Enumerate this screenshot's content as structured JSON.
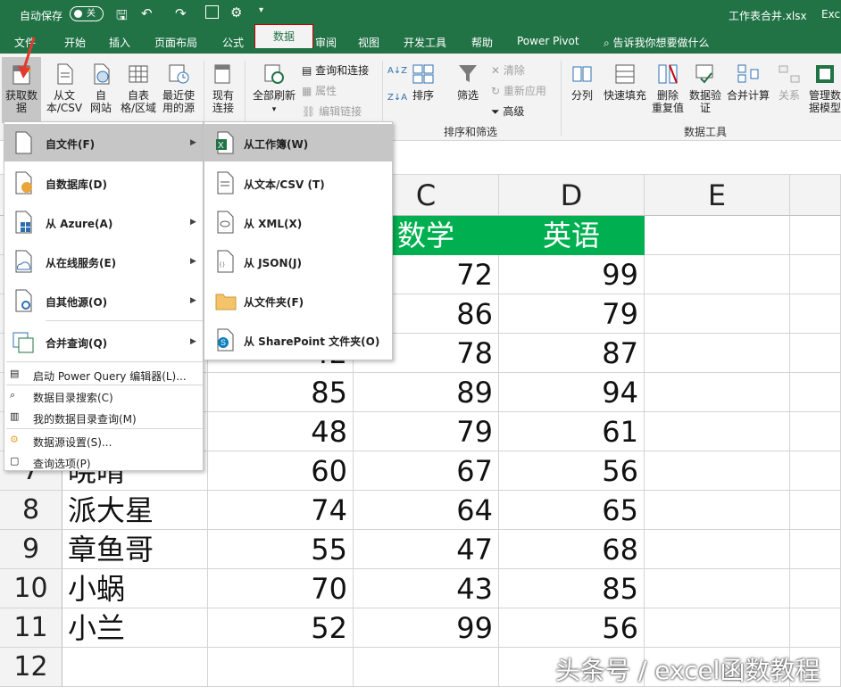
{
  "titlebar": {
    "autosave_label": "自动保存",
    "autosave_state": "关",
    "filename": "工作表合并.xlsx",
    "app": "Exc"
  },
  "menu_tabs": [
    "文件",
    "开始",
    "插入",
    "页面布局",
    "公式",
    "数据",
    "审阅",
    "视图",
    "开发工具",
    "帮助",
    "Power Pivot"
  ],
  "active_tab": "数据",
  "tell_me": "告诉我你想要做什么",
  "ribbon": {
    "get_data": "获取数\n据",
    "from_text_csv": "从文\n本/CSV",
    "from_web": "自\n网站",
    "from_table": "自表\n格/区域",
    "recent_sources": "最近使\n用的源",
    "existing_conn": "现有\n连接",
    "refresh_all": "全部刷新",
    "queries_conn": "查询和连接",
    "properties": "属性",
    "edit_links": "编辑链接",
    "sort_az": "A↓Z",
    "sort_za": "Z↓A",
    "sort": "排序",
    "filter": "筛选",
    "clear": "清除",
    "reapply": "重新应用",
    "advanced": "高级",
    "sort_filter_group": "排序和筛选",
    "split": "分列",
    "flash_fill": "快速填充",
    "remove_dup": "删除\n重复值",
    "validation": "数据验\n证",
    "consolidate": "合并计算",
    "relations": "关系",
    "manage_model": "管理数\n据模型",
    "data_tools_group": "数据工具"
  },
  "columns": [
    "C",
    "D",
    "E"
  ],
  "rows": [
    {
      "n": "",
      "name": "",
      "b": "",
      "c": "数学",
      "d": "英语"
    },
    {
      "n": "",
      "name": "",
      "b": "",
      "c": "72",
      "d": "99"
    },
    {
      "n": "",
      "name": "",
      "b": "",
      "c": "86",
      "d": "79"
    },
    {
      "n": "",
      "name": "",
      "b": "42",
      "c": "78",
      "d": "87"
    },
    {
      "n": "",
      "name": "",
      "b": "85",
      "c": "89",
      "d": "94"
    },
    {
      "n": "",
      "name": "",
      "b": "48",
      "c": "79",
      "d": "61"
    },
    {
      "n": "7",
      "name": "晓晴",
      "b": "60",
      "c": "67",
      "d": "56"
    },
    {
      "n": "8",
      "name": "派大星",
      "b": "74",
      "c": "64",
      "d": "65"
    },
    {
      "n": "9",
      "name": "章鱼哥",
      "b": "55",
      "c": "47",
      "d": "68"
    },
    {
      "n": "10",
      "name": "小蜗",
      "b": "70",
      "c": "43",
      "d": "85"
    },
    {
      "n": "11",
      "name": "小兰",
      "b": "52",
      "c": "99",
      "d": "56"
    },
    {
      "n": "12",
      "name": "",
      "b": "",
      "c": "",
      "d": ""
    }
  ],
  "main_menu": [
    {
      "label": "自文件(F)",
      "sub": true,
      "hi": true
    },
    {
      "label": "自数据库(D)",
      "sub": true
    },
    {
      "label": "从 Azure(A)",
      "sub": true
    },
    {
      "label": "从在线服务(E)",
      "sub": true
    },
    {
      "label": "自其他源(O)",
      "sub": true
    },
    {
      "label": "合并查询(Q)",
      "sub": true
    }
  ],
  "main_menu_small": [
    "启动 Power Query 编辑器(L)...",
    "数据目录搜索(C)",
    "我的数据目录查询(M)",
    "数据源设置(S)...",
    "查询选项(P)"
  ],
  "sub_menu": [
    "从工作簿(W)",
    "从文本/CSV (T)",
    "从 XML(X)",
    "从 JSON(J)",
    "从文件夹(F)",
    "从 SharePoint 文件夹(O)"
  ],
  "watermark": "头条号 / excel函数教程",
  "colors": {
    "excel_green": "#217346",
    "header_fill": "#00b050",
    "highlight": "#c6c6c6",
    "arrow_red": "#e03a2f"
  }
}
